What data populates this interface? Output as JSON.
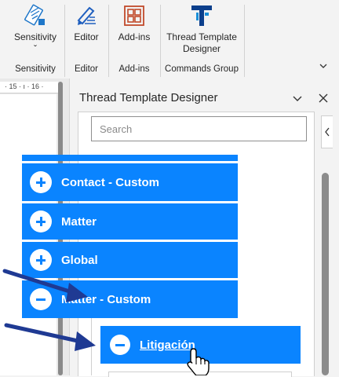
{
  "ribbon": {
    "groups": [
      {
        "button": "Sensitivity",
        "group_label": "Sensitivity",
        "icon": "sensitivity-icon"
      },
      {
        "button": "Editor",
        "group_label": "Editor",
        "icon": "editor-pen-icon"
      },
      {
        "button": "Add-ins",
        "group_label": "Add-ins",
        "icon": "add-ins-grid-icon"
      },
      {
        "button_line1": "Thread Template",
        "button_line2": "Designer",
        "group_label": "Commands Group",
        "icon": "thread-template-logo-icon"
      }
    ],
    "sensitivity_caret": "ˇ"
  },
  "ruler": {
    "marks": "· 15 · ı · 16 ·"
  },
  "pane": {
    "title": "Thread Template Designer",
    "search_placeholder": "Search",
    "sections": [
      {
        "label": "Contact - Custom",
        "expanded": false
      },
      {
        "label": "Matter",
        "expanded": false
      },
      {
        "label": "Global",
        "expanded": false
      },
      {
        "label": "Matter - Custom",
        "expanded": true
      }
    ],
    "subsection": {
      "label": "Litigación",
      "expanded": true
    }
  },
  "colors": {
    "accent": "#0a84ff",
    "arrow": "#1f3a93"
  }
}
